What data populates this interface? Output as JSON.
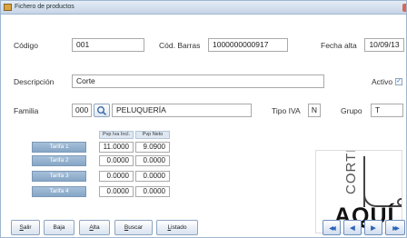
{
  "window": {
    "title": "Fichero de productos"
  },
  "fields": {
    "codigo": {
      "label": "Código",
      "value": "001"
    },
    "cod_barras": {
      "label": "Cód. Barras",
      "value": "1000000000917"
    },
    "fecha_alta": {
      "label": "Fecha alta",
      "value": "10/09/13"
    },
    "descripcion": {
      "label": "Descripción",
      "value": "Corte"
    },
    "activo": {
      "label": "Activo",
      "checked": true,
      "mark": "✓"
    },
    "familia": {
      "label": "Familia",
      "code": "000",
      "name": "PELUQUERÍA"
    },
    "tipo_iva": {
      "label": "Tipo IVA",
      "value": "N"
    },
    "grupo": {
      "label": "Grupo",
      "value": "T"
    }
  },
  "tarifas": {
    "headers": [
      "Pvp Iva Incl.",
      "Pvp Neto"
    ],
    "rows": [
      {
        "label": "Tarifa 1",
        "pvp_iva": "11.0000",
        "pvp_neto": "9.0900"
      },
      {
        "label": "Tarifa 2",
        "pvp_iva": "0.0000",
        "pvp_neto": "0.0000"
      },
      {
        "label": "Tarifa 3",
        "pvp_iva": "0.0000",
        "pvp_neto": "0.0000"
      },
      {
        "label": "Tarifa 4",
        "pvp_iva": "0.0000",
        "pvp_neto": "0.0000"
      }
    ]
  },
  "logo": {
    "line1": "CORTE",
    "line2": "AQUÍ"
  },
  "buttons": {
    "salir": {
      "hotkey": "S",
      "rest": "alir"
    },
    "baja": {
      "hotkey": "",
      "rest": "Baja"
    },
    "alta": {
      "hotkey": "A",
      "rest": "lta"
    },
    "buscar": {
      "hotkey": "B",
      "rest": "uscar"
    },
    "listado": {
      "hotkey": "L",
      "rest": "istado"
    }
  },
  "nav": {
    "first": "◀◀",
    "prev": "◀",
    "next": "▶",
    "last": "▶▶"
  },
  "icons": {
    "search": "search-icon",
    "app": "app-icon"
  },
  "colors": {
    "titlebar": "#c6d4e6",
    "tarifa_label": "#86a6c6",
    "nav_arrow": "#2d63b8"
  }
}
